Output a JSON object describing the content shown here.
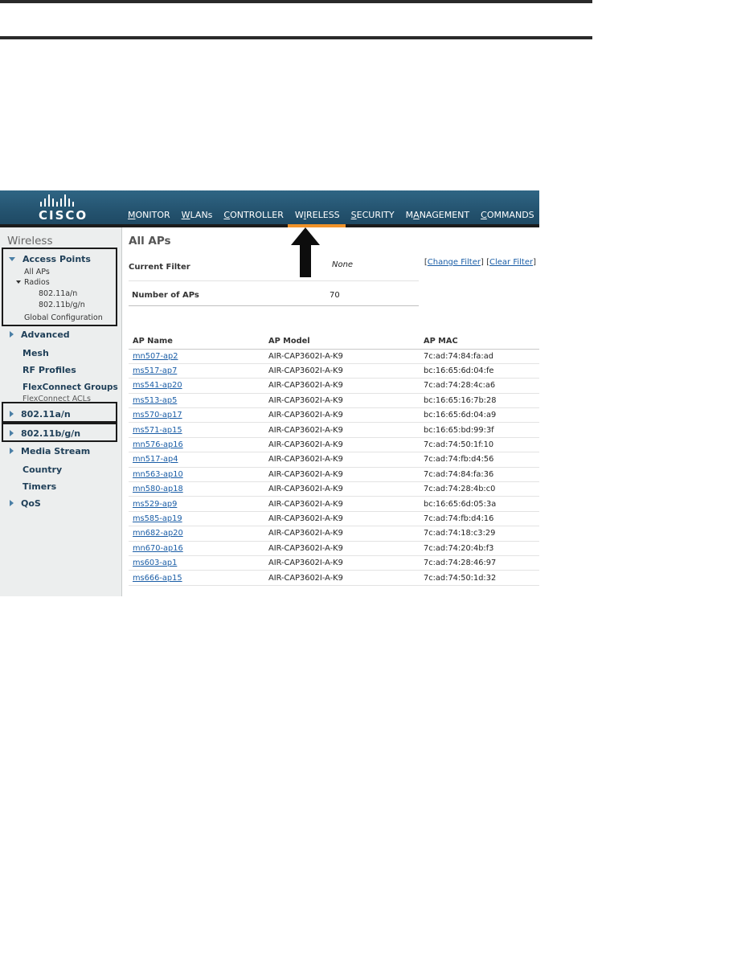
{
  "header": {
    "logo_text": "CISCO",
    "nav": [
      {
        "pre": "",
        "ul": "M",
        "post": "ONITOR"
      },
      {
        "pre": "",
        "ul": "W",
        "post": "LANs"
      },
      {
        "pre": "",
        "ul": "C",
        "post": "ONTROLLER"
      },
      {
        "pre": "W",
        "ul": "I",
        "post": "RELESS"
      },
      {
        "pre": "",
        "ul": "S",
        "post": "ECURITY"
      },
      {
        "pre": "M",
        "ul": "A",
        "post": "NAGEMENT"
      },
      {
        "pre": "",
        "ul": "C",
        "post": "OMMANDS"
      }
    ],
    "active_color": "#f0922a"
  },
  "sidebar": {
    "title": "Wireless",
    "access_points": "Access Points",
    "all_aps": "All APs",
    "radios": "Radios",
    "radio_a": "802.11a/n",
    "radio_bg": "802.11b/g/n",
    "global_config": "Global Configuration",
    "advanced": "Advanced",
    "mesh": "Mesh",
    "rf_profiles": "RF Profiles",
    "flexconnect_groups": "FlexConnect Groups",
    "flexconnect_acls": "FlexConnect ACLs",
    "net_a": "802.11a/n",
    "net_bg": "802.11b/g/n",
    "media_stream": "Media Stream",
    "country": "Country",
    "timers": "Timers",
    "qos": "QoS"
  },
  "main": {
    "title": "All APs",
    "current_filter_label": "Current Filter",
    "current_filter_value": "None",
    "change_filter": "Change Filter",
    "clear_filter": "Clear Filter",
    "count_label": "Number of APs",
    "count_value": "70",
    "columns": [
      "AP Name",
      "AP Model",
      "AP MAC"
    ],
    "rows": [
      [
        "mn507-ap2",
        "AIR-CAP3602I-A-K9",
        "7c:ad:74:84:fa:ad"
      ],
      [
        "ms517-ap7",
        "AIR-CAP3602I-A-K9",
        "bc:16:65:6d:04:fe"
      ],
      [
        "ms541-ap20",
        "AIR-CAP3602I-A-K9",
        "7c:ad:74:28:4c:a6"
      ],
      [
        "ms513-ap5",
        "AIR-CAP3602I-A-K9",
        "bc:16:65:16:7b:28"
      ],
      [
        "ms570-ap17",
        "AIR-CAP3602I-A-K9",
        "bc:16:65:6d:04:a9"
      ],
      [
        "ms571-ap15",
        "AIR-CAP3602I-A-K9",
        "bc:16:65:bd:99:3f"
      ],
      [
        "mn576-ap16",
        "AIR-CAP3602I-A-K9",
        "7c:ad:74:50:1f:10"
      ],
      [
        "mn517-ap4",
        "AIR-CAP3602I-A-K9",
        "7c:ad:74:fb:d4:56"
      ],
      [
        "mn563-ap10",
        "AIR-CAP3602I-A-K9",
        "7c:ad:74:84:fa:36"
      ],
      [
        "mn580-ap18",
        "AIR-CAP3602I-A-K9",
        "7c:ad:74:28:4b:c0"
      ],
      [
        "ms529-ap9",
        "AIR-CAP3602I-A-K9",
        "bc:16:65:6d:05:3a"
      ],
      [
        "ms585-ap19",
        "AIR-CAP3602I-A-K9",
        "7c:ad:74:fb:d4:16"
      ],
      [
        "mn682-ap20",
        "AIR-CAP3602I-A-K9",
        "7c:ad:74:18:c3:29"
      ],
      [
        "mn670-ap16",
        "AIR-CAP3602I-A-K9",
        "7c:ad:74:20:4b:f3"
      ],
      [
        "ms603-ap1",
        "AIR-CAP3602I-A-K9",
        "7c:ad:74:28:46:97"
      ],
      [
        "ms666-ap15",
        "AIR-CAP3602I-A-K9",
        "7c:ad:74:50:1d:32"
      ]
    ]
  }
}
